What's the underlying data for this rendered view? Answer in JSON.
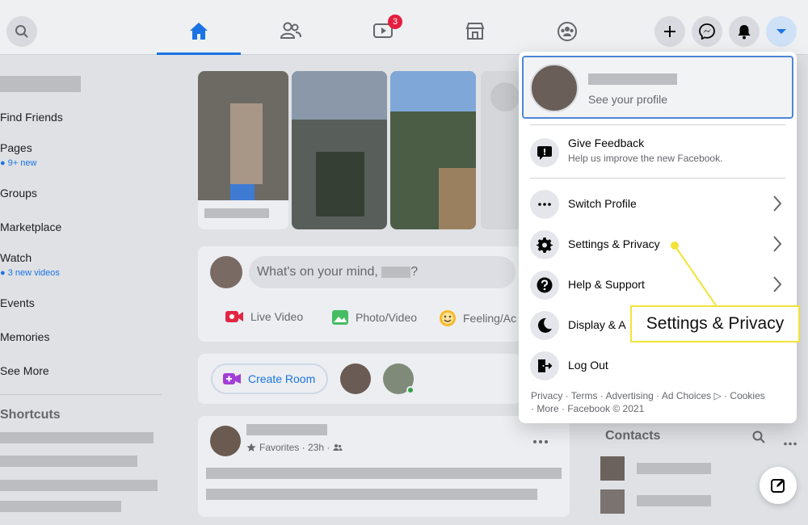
{
  "nav": {
    "watch_badge": "3"
  },
  "left": {
    "find_friends": "Find Friends",
    "pages": "Pages",
    "pages_sub": "9+ new",
    "groups": "Groups",
    "marketplace": "Marketplace",
    "watch": "Watch",
    "watch_sub": "3 new videos",
    "events": "Events",
    "memories": "Memories",
    "see_more": "See More",
    "shortcuts": "Shortcuts"
  },
  "composer": {
    "placeholder": "What's on your mind,",
    "suffix": "?",
    "live_video": "Live Video",
    "photo_video": "Photo/Video",
    "feeling": "Feeling/Ac"
  },
  "rooms": {
    "create_room": "Create Room"
  },
  "post": {
    "meta": "Favorites · 23h ·"
  },
  "dropdown": {
    "see_profile": "See your profile",
    "feedback_title": "Give Feedback",
    "feedback_sub": "Help us improve the new Facebook.",
    "switch_profile": "Switch Profile",
    "settings_privacy": "Settings & Privacy",
    "help_support": "Help & Support",
    "display": "Display & A",
    "log_out": "Log Out",
    "footer_line1": "Privacy · Terms · Advertising · Ad Choices ▷ · Cookies",
    "footer_line2": "· More · Facebook © 2021"
  },
  "contacts": {
    "title": "Contacts"
  },
  "callout": {
    "text": "Settings & Privacy"
  },
  "colors": {
    "accent": "#1b74e4",
    "badge": "#e41e3f",
    "callout_border": "#f3e33a",
    "live_video": "#e42645",
    "photo_video": "#45bd62",
    "feeling": "#f7b928"
  },
  "icons": [
    "search-icon",
    "home-icon",
    "friends-icon",
    "watch-icon",
    "marketplace-icon",
    "groups-icon",
    "plus-icon",
    "messenger-icon",
    "bell-icon",
    "caret-down-icon",
    "feedback-icon",
    "dots-icon",
    "gear-icon",
    "help-icon",
    "moon-icon",
    "logout-icon",
    "chevron-right-icon",
    "compose-icon"
  ]
}
